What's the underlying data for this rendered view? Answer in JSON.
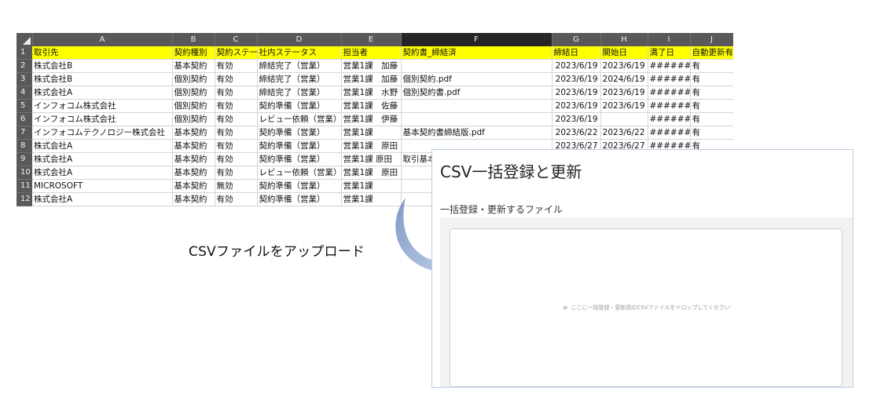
{
  "sheet": {
    "columns": [
      "A",
      "B",
      "C",
      "D",
      "E",
      "F",
      "G",
      "H",
      "I",
      "J"
    ],
    "selected_column": "F",
    "row_numbers": [
      "1",
      "2",
      "3",
      "4",
      "5",
      "6",
      "7",
      "8",
      "9",
      "10",
      "11",
      "12"
    ],
    "header": [
      "取引先",
      "契約種別",
      "契約ステータス",
      "社内ステータス",
      "担当者",
      "契約書_締結済",
      "締結日",
      "開始日",
      "満了日",
      "自動更新有"
    ],
    "rows": [
      [
        "株式会社B",
        "基本契約",
        "有効",
        "締結完了（営業）",
        "営業1課　加藤",
        "",
        "2023/6/19",
        "2023/6/19",
        "######",
        "有"
      ],
      [
        "株式会社B",
        "個別契約",
        "有効",
        "締結完了（営業）",
        "営業1課　加藤",
        "個別契約.pdf",
        "2023/6/19",
        "2024/6/19",
        "######",
        "有"
      ],
      [
        "株式会社A",
        "個別契約",
        "有効",
        "締結完了（営業）",
        "営業1課　水野",
        "個別契約書.pdf",
        "2023/6/19",
        "2023/6/19",
        "######",
        "有"
      ],
      [
        "インフォコム株式会社",
        "個別契約",
        "有効",
        "契約準備（営業）",
        "営業1課　佐藤",
        "",
        "2023/6/19",
        "2023/6/19",
        "######",
        "有"
      ],
      [
        "インフォコム株式会社",
        "個別契約",
        "有効",
        "レビュー依頼（営業）",
        "営業1課　伊藤",
        "",
        "2023/6/19",
        "",
        "######",
        "有"
      ],
      [
        "インフォコムテクノロジー株式会社",
        "基本契約",
        "有効",
        "契約準備（営業）",
        "営業1課",
        "基本契約書締結版.pdf",
        "2023/6/22",
        "2023/6/22",
        "######",
        "有"
      ],
      [
        "株式会社A",
        "基本契約",
        "有効",
        "契約準備（営業）",
        "営業1課　原田",
        "",
        "2023/6/27",
        "2023/6/27",
        "######",
        "有"
      ],
      [
        "株式会社A",
        "基本契約",
        "有効",
        "契約準備（営業）",
        "営業1課 原田",
        "取引基本",
        "",
        "",
        "",
        ""
      ],
      [
        "株式会社A",
        "基本契約",
        "有効",
        "レビュー依頼（営業）",
        "営業1課　原田",
        "",
        "",
        "",
        "",
        ""
      ],
      [
        "MICROSOFT",
        "基本契約",
        "無効",
        "契約準備（営業）",
        "営業1課",
        "",
        "",
        "",
        "",
        ""
      ],
      [
        "株式会社A",
        "基本契約",
        "有効",
        "契約準備（営業）",
        "営業1課",
        "",
        "",
        "",
        "",
        ""
      ]
    ]
  },
  "label": {
    "upload": "CSVファイルをアップロード"
  },
  "dialog": {
    "title": "CSV一括登録と更新",
    "section_label": "一括登録・更新するファイル",
    "drop_text": "ここに一括登録・更新用のCSVファイルをドロップしてください",
    "plus_icon": "+"
  },
  "colors": {
    "header_fill": "#ffff00",
    "sheet_header": "#595959",
    "arrow": "#a8bedf"
  }
}
